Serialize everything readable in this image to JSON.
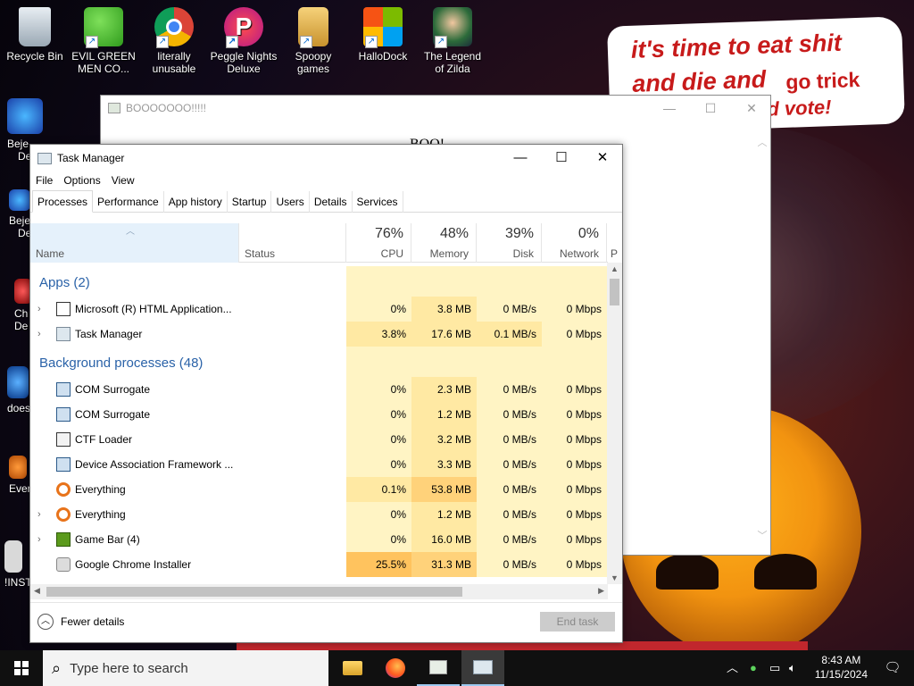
{
  "desktop": {
    "icons": [
      {
        "label": "Recycle Bin",
        "icon": "recycle-bin-icon"
      },
      {
        "label": "EVIL GREEN MEN CO...",
        "icon": "messenger-icon"
      },
      {
        "label": "literally unusable",
        "icon": "chrome-icon"
      },
      {
        "label": "Peggle Nights Deluxe",
        "icon": "peggle-icon"
      },
      {
        "label": "Spoopy games",
        "icon": "folder-icon"
      },
      {
        "label": "HalloDock",
        "icon": "windows-logo-icon"
      },
      {
        "label": "The Legend of Zilda",
        "icon": "zelda-icon"
      }
    ],
    "left_partial": [
      {
        "label": "Beje",
        "sub": "De"
      },
      {
        "label": "Beje",
        "sub": "De"
      },
      {
        "label": "Ch",
        "sub": "De"
      },
      {
        "label": "does"
      },
      {
        "label": "Ever"
      },
      {
        "label": "!INST"
      }
    ],
    "wallpaper_text": {
      "line1": "it's time to eat shit",
      "line2a": "and die and",
      "line2b": "go trick",
      "line3": "d vote!"
    }
  },
  "hta_window": {
    "title": "BOOOOOOO!!!!!",
    "content": "BOO!"
  },
  "task_manager": {
    "title": "Task Manager",
    "menu": [
      "File",
      "Options",
      "View"
    ],
    "tabs": [
      "Processes",
      "Performance",
      "App history",
      "Startup",
      "Users",
      "Details",
      "Services"
    ],
    "active_tab": "Processes",
    "columns": {
      "name": "Name",
      "status": "Status",
      "cpu": {
        "pct": "76%",
        "label": "CPU"
      },
      "memory": {
        "pct": "48%",
        "label": "Memory"
      },
      "disk": {
        "pct": "39%",
        "label": "Disk"
      },
      "network": {
        "pct": "0%",
        "label": "Network"
      },
      "power": "P"
    },
    "groups": [
      {
        "name": "Apps (2)",
        "rows": [
          {
            "name": "Microsoft (R) HTML Application...",
            "expand": true,
            "cpu": "0%",
            "memory": "3.8 MB",
            "disk": "0 MB/s",
            "network": "0 Mbps",
            "icon": "hta-window-icon"
          },
          {
            "name": "Task Manager",
            "expand": true,
            "cpu": "3.8%",
            "memory": "17.6 MB",
            "disk": "0.1 MB/s",
            "network": "0 Mbps",
            "icon": "task-manager-icon"
          }
        ]
      },
      {
        "name": "Background processes (48)",
        "rows": [
          {
            "name": "COM Surrogate",
            "expand": false,
            "cpu": "0%",
            "memory": "2.3 MB",
            "disk": "0 MB/s",
            "network": "0 Mbps",
            "icon": "window-icon"
          },
          {
            "name": "COM Surrogate",
            "expand": false,
            "cpu": "0%",
            "memory": "1.2 MB",
            "disk": "0 MB/s",
            "network": "0 Mbps",
            "icon": "window-icon"
          },
          {
            "name": "CTF Loader",
            "expand": false,
            "cpu": "0%",
            "memory": "3.2 MB",
            "disk": "0 MB/s",
            "network": "0 Mbps",
            "icon": "pen-icon"
          },
          {
            "name": "Device Association Framework ...",
            "expand": false,
            "cpu": "0%",
            "memory": "3.3 MB",
            "disk": "0 MB/s",
            "network": "0 Mbps",
            "icon": "window-icon"
          },
          {
            "name": "Everything",
            "expand": false,
            "cpu": "0.1%",
            "memory": "53.8 MB",
            "disk": "0 MB/s",
            "network": "0 Mbps",
            "icon": "magnifier-icon"
          },
          {
            "name": "Everything",
            "expand": true,
            "cpu": "0%",
            "memory": "1.2 MB",
            "disk": "0 MB/s",
            "network": "0 Mbps",
            "icon": "magnifier-icon"
          },
          {
            "name": "Game Bar (4)",
            "expand": true,
            "cpu": "0%",
            "memory": "16.0 MB",
            "disk": "0 MB/s",
            "network": "0 Mbps",
            "icon": "game-bar-icon"
          },
          {
            "name": "Google Chrome Installer",
            "expand": false,
            "cpu": "25.5%",
            "memory": "31.3 MB",
            "disk": "0 MB/s",
            "network": "0 Mbps",
            "icon": "installer-icon"
          }
        ]
      }
    ],
    "fewer_details": "Fewer details",
    "end_task": "End task"
  },
  "taskbar": {
    "search_placeholder": "Type here to search",
    "time": "8:43 AM",
    "date": "11/15/2024"
  },
  "colors": {
    "heat_low": "#fff4c4",
    "heat_mid": "#ffe9a3",
    "heat_high": "#ffd27a",
    "heat_hot": "#ffc35e",
    "group_text": "#2a62a8",
    "wallpaper_text": "#c71a1a"
  }
}
